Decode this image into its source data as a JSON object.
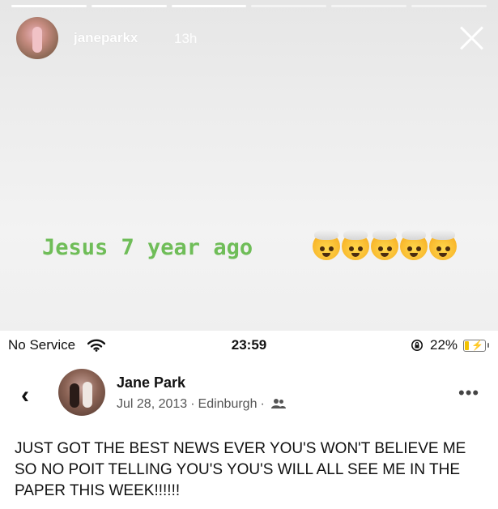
{
  "story": {
    "username": "janeparkx",
    "time": "13h",
    "caption": "Jesus 7 year ago",
    "emoji_icon": "exploding-head-emoji",
    "emoji_count": 5,
    "caption_color": "#6fbd58",
    "progress_segments": 6,
    "progress_completed": 3
  },
  "status_bar": {
    "carrier": "No Service",
    "time": "23:59",
    "battery": "22%",
    "battery_level": 0.22
  },
  "post": {
    "author": "Jane Park",
    "date": "Jul 28, 2013",
    "location": "Edinburgh",
    "separator": "·",
    "text": "JUST GOT THE BEST NEWS EVER YOU'S WON'T BELIEVE ME SO NO POIT TELLING YOU'S YOU'S WILL ALL SEE ME IN THE PAPER THIS WEEK!!!!!!"
  }
}
